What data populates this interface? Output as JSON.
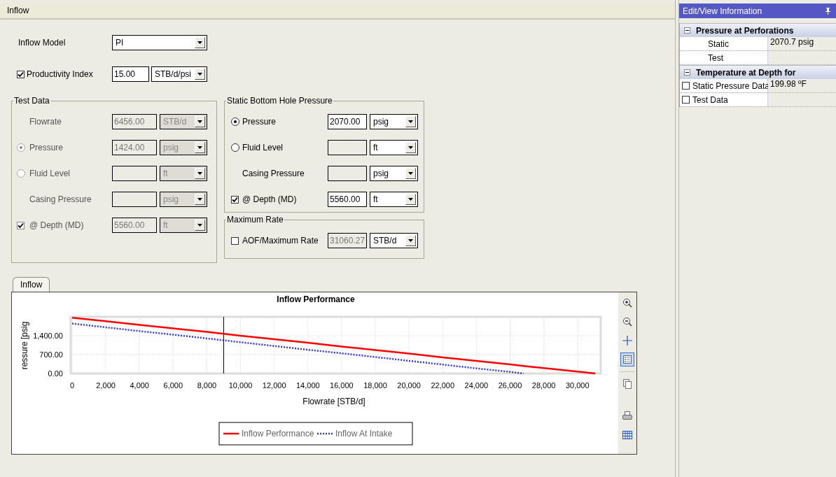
{
  "window": {
    "title": "Inflow"
  },
  "inflow_model": {
    "label": "Inflow Model",
    "value": "PI"
  },
  "productivity_index": {
    "label": "Productivity Index",
    "checked": true,
    "value": "15.00",
    "unit": "STB/d/psi"
  },
  "groups": [
    {
      "title": "Test Data",
      "disabled": true,
      "rows": [
        {
          "kind": "plain",
          "label": "Flowrate",
          "value": "6456.00",
          "field_disabled": true,
          "unit": "STB/d"
        },
        {
          "kind": "radio",
          "selected": true,
          "label": "Pressure",
          "value": "1424.00",
          "field_disabled": true,
          "unit": "psig"
        },
        {
          "kind": "radio",
          "selected": false,
          "label": "Fluid Level",
          "field_disabled": true,
          "unit": "ft"
        },
        {
          "kind": "plain",
          "label": "Casing Pressure",
          "field_disabled": true,
          "unit": "psig"
        },
        {
          "kind": "check",
          "checked": true,
          "label": "@ Depth (MD)",
          "value": "5560.00",
          "field_disabled": true,
          "unit": "ft"
        }
      ]
    },
    {
      "title": "Static Bottom Hole Pressure",
      "disabled": false,
      "rows": [
        {
          "kind": "radio",
          "selected": true,
          "label": "Pressure",
          "value": "2070.00",
          "field_disabled": false,
          "unit": "psig"
        },
        {
          "kind": "radio",
          "selected": false,
          "label": "Fluid Level",
          "field_disabled": true,
          "unit": "ft"
        },
        {
          "kind": "plain",
          "label": "Casing Pressure",
          "field_disabled": true,
          "unit": "psig"
        },
        {
          "kind": "check",
          "checked": true,
          "label": "@ Depth (MD)",
          "value": "5560.00",
          "field_disabled": false,
          "unit": "ft"
        }
      ]
    },
    {
      "title": "Maximum Rate",
      "disabled": false,
      "rows": [
        {
          "kind": "check",
          "checked": false,
          "label": "AOF/Maximum Rate",
          "value": "31060.27",
          "field_disabled": true,
          "unit": "STB/d"
        }
      ]
    }
  ],
  "tabs": [
    {
      "label": "Inflow",
      "selected": true
    }
  ],
  "chart_data": {
    "type": "line",
    "title": "Inflow Performance",
    "xlabel": "Flowrate [STB/d]",
    "ylabel": "ressure [psig",
    "x": [
      0,
      2000,
      4000,
      6000,
      8000,
      10000,
      12000,
      14000,
      16000,
      18000,
      20000,
      22000,
      24000,
      26000,
      26800,
      28000,
      30000,
      31060
    ],
    "series": [
      {
        "name": "Inflow Performance",
        "color": "#ff0000",
        "line_style": "solid",
        "values": [
          2070,
          1940,
          1800,
          1670,
          1540,
          1400,
          1270,
          1140,
          1000,
          870,
          740,
          600,
          470,
          340,
          280,
          200,
          70,
          0
        ]
      },
      {
        "name": "Inflow At Intake",
        "color": "#3333ff",
        "line_style": "dotted",
        "values": [
          1850,
          1710,
          1570,
          1440,
          1300,
          1160,
          1020,
          880,
          750,
          610,
          470,
          330,
          190,
          60,
          0,
          null,
          null,
          null
        ]
      }
    ],
    "grid": true,
    "legend": "bottom",
    "xlim": [
      0,
      31300
    ],
    "ylim": [
      0,
      2100
    ],
    "xticks": [
      {
        "value": 0,
        "label": "0"
      },
      {
        "value": 2000,
        "label": "2,000"
      },
      {
        "value": 4000,
        "label": "4,000"
      },
      {
        "value": 6000,
        "label": "6,000"
      },
      {
        "value": 8000,
        "label": "8,000"
      },
      {
        "value": 10000,
        "label": "10,000"
      },
      {
        "value": 12000,
        "label": "12,000"
      },
      {
        "value": 14000,
        "label": "14,000"
      },
      {
        "value": 16000,
        "label": "16,000"
      },
      {
        "value": 18000,
        "label": "18,000"
      },
      {
        "value": 20000,
        "label": "20,000"
      },
      {
        "value": 22000,
        "label": "22,000"
      },
      {
        "value": 24000,
        "label": "24,000"
      },
      {
        "value": 26000,
        "label": "26,000"
      },
      {
        "value": 28000,
        "label": "28,000"
      },
      {
        "value": 30000,
        "label": "30,000"
      }
    ],
    "yticks": [
      {
        "value": 0,
        "label": "0.00"
      },
      {
        "value": 700,
        "label": "700.00"
      },
      {
        "value": 1400,
        "label": "1,400.00"
      }
    ],
    "ref_lines": [
      {
        "axis": "x",
        "value": 9000
      }
    ]
  },
  "chart_toolbar": [
    {
      "kind": "zoom_in",
      "selected": false
    },
    {
      "kind": "zoom_out",
      "selected": false
    },
    {
      "kind": "crosshair",
      "selected": false
    },
    {
      "kind": "legend",
      "selected": true
    },
    {
      "kind": "copy",
      "selected": false
    },
    {
      "kind": "print",
      "selected": false
    },
    {
      "kind": "table",
      "selected": false
    }
  ],
  "info_panel": {
    "title": "Edit/View Information",
    "sections": [
      {
        "title": "Pressure at Perforations",
        "expanded": true,
        "rows": [
          {
            "kind": "plain",
            "label": "Static",
            "value": "2070.7 psig"
          },
          {
            "kind": "plain",
            "label": "Test"
          }
        ]
      },
      {
        "title": "Temperature at Depth for",
        "expanded": true,
        "rows": [
          {
            "kind": "check",
            "checked": false,
            "label": "Static Pressure Data",
            "value": "199.98 ºF"
          },
          {
            "kind": "check",
            "checked": false,
            "label": "Test Data"
          }
        ]
      }
    ]
  }
}
